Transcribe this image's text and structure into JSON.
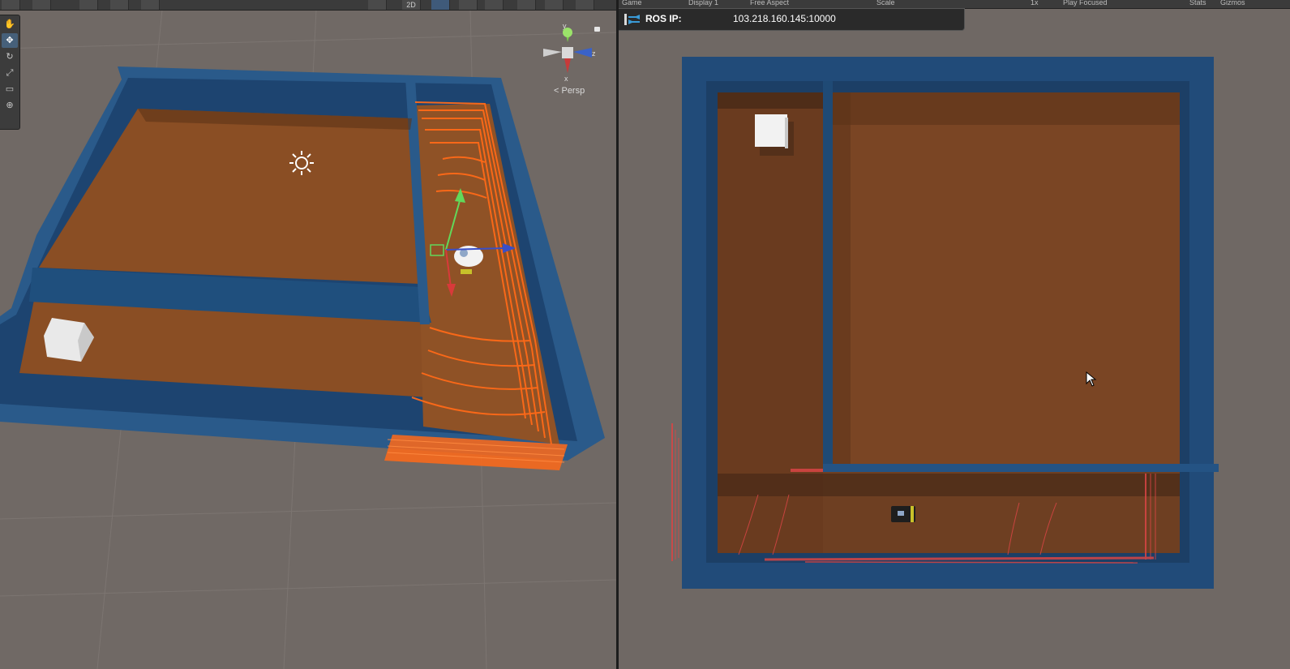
{
  "scene": {
    "toolbar": {
      "buttons": [
        "draw-mode-dropdown",
        "shading-dropdown",
        "pivot-toggle",
        "global-local-toggle",
        "grid-snap",
        "2D",
        "light-toggle",
        "audio-toggle",
        "effects-dropdown",
        "visibility-toggle",
        "camera-dropdown",
        "gizmos-dropdown"
      ],
      "label_2d": "2D"
    },
    "tools": [
      "hand-tool",
      "move-tool",
      "rotate-tool",
      "scale-tool",
      "rect-tool",
      "transform-tool"
    ],
    "gizmo": {
      "axis_y": "y",
      "axis_z": "z",
      "axis_x": "x",
      "persp_label": "< Persp"
    }
  },
  "game": {
    "toolbar": {
      "tab": "Game",
      "display": "Display 1",
      "aspect": "Free Aspect",
      "scale_label": "Scale",
      "scale_value": "1x",
      "play_mode": "Play Focused",
      "stats": "Stats",
      "gizmos": "Gizmos"
    },
    "ros": {
      "label": "ROS IP:",
      "value": "103.218.160.145:10000"
    }
  },
  "colors": {
    "wall": "#1f4a75",
    "floor": "#6b3d20",
    "laser_scene": "#ff6a18",
    "laser_game": "#d94545",
    "background": "#6f6864"
  }
}
